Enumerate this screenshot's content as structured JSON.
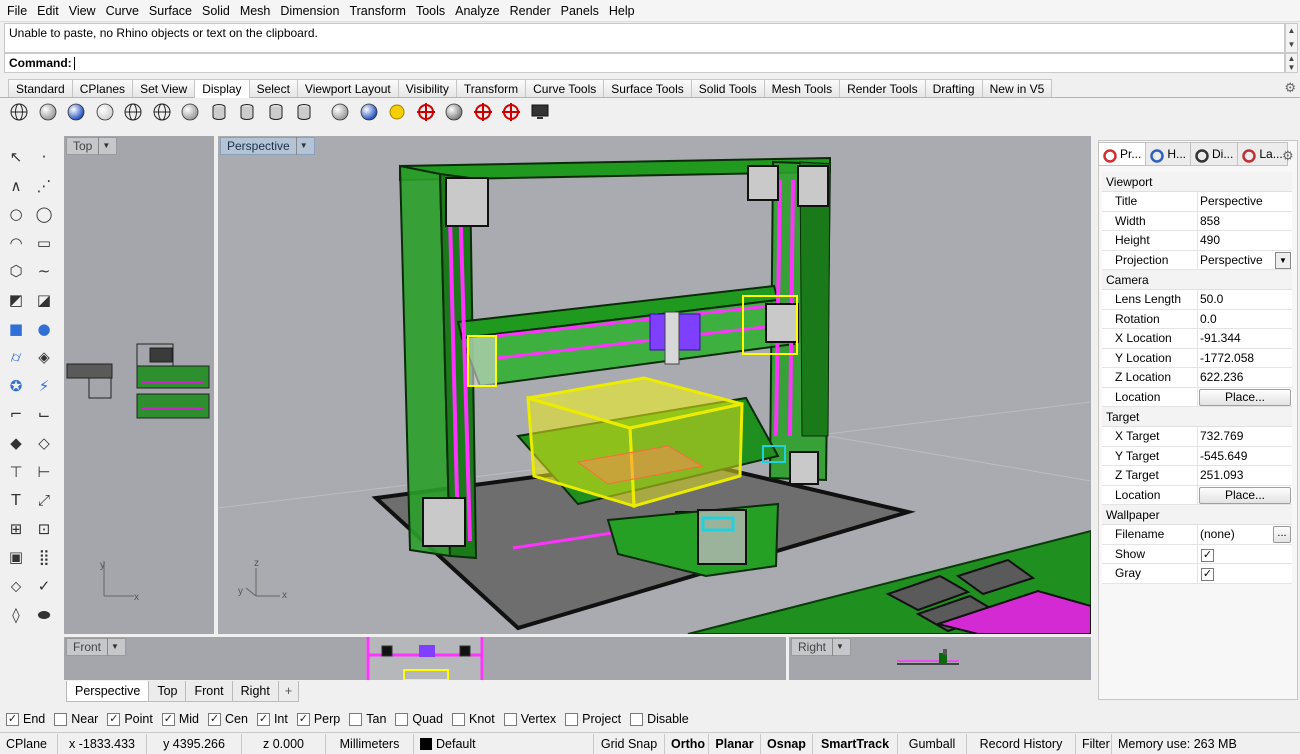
{
  "menu": [
    "File",
    "Edit",
    "View",
    "Curve",
    "Surface",
    "Solid",
    "Mesh",
    "Dimension",
    "Transform",
    "Tools",
    "Analyze",
    "Render",
    "Panels",
    "Help"
  ],
  "command": {
    "history": "Unable to paste, no Rhino objects or text on the clipboard.",
    "prompt": "Command:",
    "value": ""
  },
  "toolbar_tabs": {
    "items": [
      "Standard",
      "CPlanes",
      "Set View",
      "Display",
      "Select",
      "Viewport Layout",
      "Visibility",
      "Transform",
      "Curve Tools",
      "Surface Tools",
      "Solid Tools",
      "Mesh Tools",
      "Render Tools",
      "Drafting",
      "New in V5"
    ],
    "active": "Display"
  },
  "toolbar_icons": [
    "wireframe-icon",
    "shaded-icon",
    "rendered-icon",
    "ghosted-icon",
    "xray-icon",
    "technical-icon",
    "artistic-icon",
    "pen-icon",
    "shade-selected-icon",
    "wireframe-selected-icon",
    "isocurve-icon",
    "render-mesh-icon",
    "lights-icon",
    "environment-icon",
    "sun-icon",
    "ground-plane-icon",
    "safe-frame-icon",
    "clipping-plane-icon",
    "display-monitor-icon"
  ],
  "palette_icons": [
    "select-icon",
    "point-icon",
    "polyline-icon",
    "control-point-curve-icon",
    "circle-icon",
    "ellipse-icon",
    "arc-icon",
    "rectangle-icon",
    "polygon-icon",
    "free-form-curve-icon",
    "surface-corner-points-icon",
    "extrude-icon",
    "box-icon",
    "sphere-icon",
    "cylinder-icon",
    "mesh-icon",
    "boolean-union-icon",
    "boolean-difference-icon",
    "fillet-icon",
    "offset-icon",
    "group-icon",
    "ungroup-icon",
    "join-icon",
    "explode-icon",
    "text-icon",
    "dimension-icon",
    "block-icon",
    "array-icon",
    "snap-grid-icon",
    "align-icon",
    "analyze-icon",
    "check-icon",
    "render-icon",
    "material-icon"
  ],
  "viewports": {
    "top": "Top",
    "perspective": "Perspective",
    "front": "Front",
    "right": "Right"
  },
  "viewport_tabs": {
    "items": [
      "Perspective",
      "Top",
      "Front",
      "Right"
    ],
    "add": "+",
    "active": "Perspective"
  },
  "osnap": [
    {
      "label": "End",
      "checked": true
    },
    {
      "label": "Near",
      "checked": false
    },
    {
      "label": "Point",
      "checked": true
    },
    {
      "label": "Mid",
      "checked": true
    },
    {
      "label": "Cen",
      "checked": true
    },
    {
      "label": "Int",
      "checked": true
    },
    {
      "label": "Perp",
      "checked": true
    },
    {
      "label": "Tan",
      "checked": false
    },
    {
      "label": "Quad",
      "checked": false
    },
    {
      "label": "Knot",
      "checked": false
    },
    {
      "label": "Vertex",
      "checked": false
    },
    {
      "label": "Project",
      "checked": false
    },
    {
      "label": "Disable",
      "checked": false
    }
  ],
  "status": {
    "cplane": "CPlane",
    "x": "x -1833.433",
    "y": "y 4395.266",
    "z": "z 0.000",
    "units": "Millimeters",
    "layer": "Default",
    "layer_color": "#000000",
    "grid_snap": "Grid Snap",
    "ortho": "Ortho",
    "planar": "Planar",
    "osnap": "Osnap",
    "smarttrack": "SmartTrack",
    "gumball": "Gumball",
    "record_history": "Record History",
    "filter": "Filter",
    "memory": "Memory use: 263 MB"
  },
  "panel": {
    "tabs": [
      {
        "label": "Pr...",
        "icon": "properties-icon"
      },
      {
        "label": "H...",
        "icon": "help-icon"
      },
      {
        "label": "Di...",
        "icon": "display-icon"
      },
      {
        "label": "La...",
        "icon": "layers-icon"
      }
    ],
    "viewport_header": "Viewport",
    "viewport": [
      {
        "k": "Title",
        "v": "Perspective"
      },
      {
        "k": "Width",
        "v": "858"
      },
      {
        "k": "Height",
        "v": "490"
      },
      {
        "k": "Projection",
        "v": "Perspective"
      }
    ],
    "camera_header": "Camera",
    "camera": [
      {
        "k": "Lens Length",
        "v": "50.0"
      },
      {
        "k": "Rotation",
        "v": "0.0"
      },
      {
        "k": "X Location",
        "v": "-91.344"
      },
      {
        "k": "Y Location",
        "v": "-1772.058"
      },
      {
        "k": "Z Location",
        "v": "622.236"
      },
      {
        "k": "Location",
        "v": "Place..."
      }
    ],
    "target_header": "Target",
    "target": [
      {
        "k": "X Target",
        "v": "732.769"
      },
      {
        "k": "Y Target",
        "v": "-545.649"
      },
      {
        "k": "Z Target",
        "v": "251.093"
      },
      {
        "k": "Location",
        "v": "Place..."
      }
    ],
    "wallpaper_header": "Wallpaper",
    "wallpaper": [
      {
        "k": "Filename",
        "v": "(none)",
        "button": "..."
      },
      {
        "k": "Show",
        "checked": true
      },
      {
        "k": "Gray",
        "checked": true
      }
    ]
  },
  "colors": {
    "viewport_bg": "#a9abb0",
    "model_green": "#1f9a1f",
    "selection_yellow": "#f0f000",
    "magenta": "#ff00ff",
    "active_viewport_title": "#b3c4d6"
  }
}
